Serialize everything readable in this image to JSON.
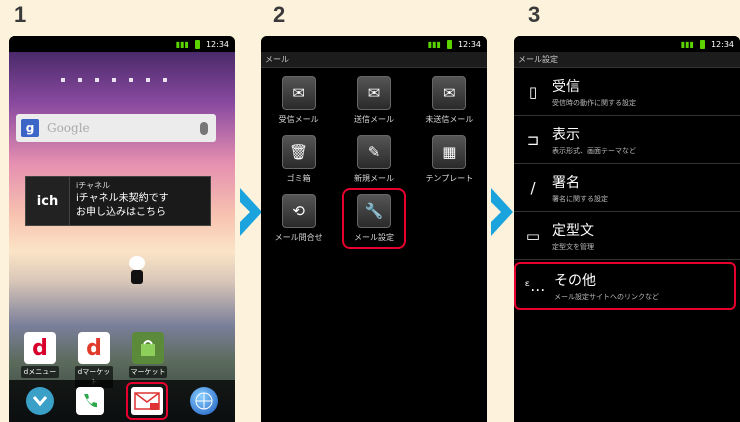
{
  "steps": [
    "1",
    "2",
    "3"
  ],
  "status_time": "12:34",
  "phone1": {
    "search_placeholder": "Google",
    "ich": {
      "logo": "ich",
      "title": "iチャネル",
      "msg_line1": "iチャネル未契約です",
      "msg_line2": "お申し込みはこちら"
    },
    "apps": [
      {
        "label": "dメニュー",
        "glyph": "d",
        "color": "#d8002a"
      },
      {
        "label": "dマーケット",
        "glyph": "d",
        "color": "#e03a2a"
      },
      {
        "label": "マーケット",
        "glyph": "",
        "color": "#5a8a3a"
      }
    ],
    "dock": [
      "chevron-down-icon",
      "phone-icon",
      "mail-icon",
      "globe-icon"
    ]
  },
  "phone2": {
    "title": "メール",
    "items": [
      {
        "label": "受信メール",
        "icon": "inbox-icon"
      },
      {
        "label": "送信メール",
        "icon": "outbox-icon"
      },
      {
        "label": "未送信メール",
        "icon": "unsent-icon"
      },
      {
        "label": "ゴミ箱",
        "icon": "trash-icon"
      },
      {
        "label": "新規メール",
        "icon": "compose-icon"
      },
      {
        "label": "テンプレート",
        "icon": "template-icon"
      },
      {
        "label": "メール問合せ",
        "icon": "mail-inquiry-icon"
      },
      {
        "label": "メール設定",
        "icon": "mail-settings-icon"
      }
    ]
  },
  "phone3": {
    "title": "メール設定",
    "items": [
      {
        "title": "受信",
        "sub": "受信時の動作に関する設定",
        "icon": "receive-icon"
      },
      {
        "title": "表示",
        "sub": "表示形式、画面テーマなど",
        "icon": "display-icon"
      },
      {
        "title": "署名",
        "sub": "署名に関する設定",
        "icon": "signature-icon"
      },
      {
        "title": "定型文",
        "sub": "定型文を管理",
        "icon": "template-text-icon"
      },
      {
        "title": "その他",
        "sub": "メール設定サイトへのリンクなど",
        "icon": "other-icon"
      }
    ]
  },
  "colors": {
    "highlight": "#e6002e",
    "arrow": "#1aa3dc",
    "background": "#fdf3dc"
  }
}
